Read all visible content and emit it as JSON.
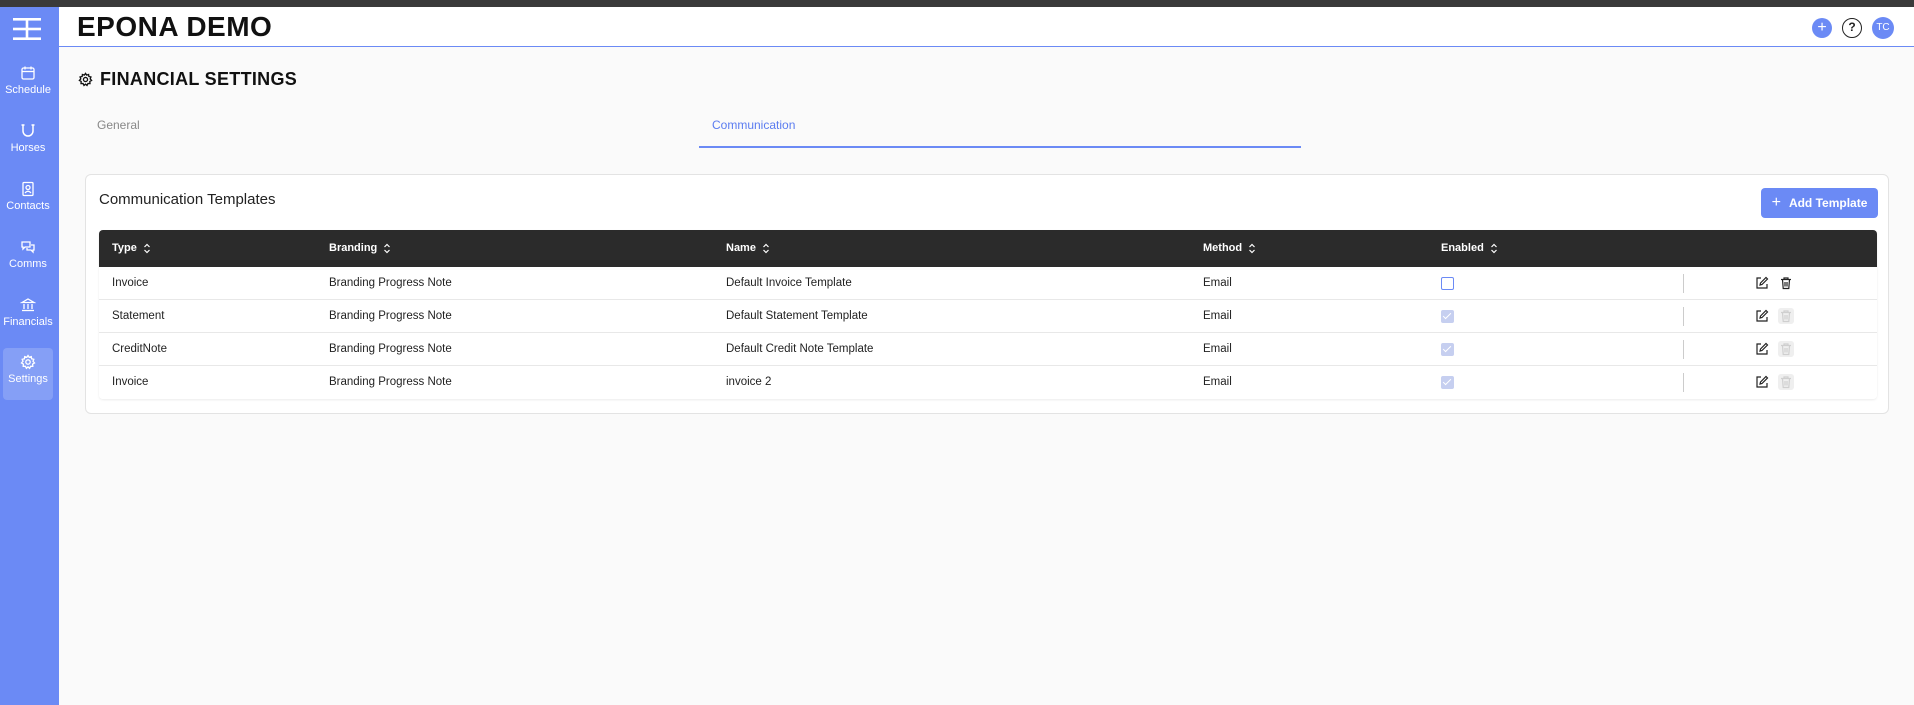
{
  "app": {
    "title": "EPONA DEMO"
  },
  "header": {
    "avatar_initials": "TC",
    "add_icon": "plus-icon",
    "help_icon": "question-circle-icon"
  },
  "sidebar": {
    "items": [
      {
        "label": "Schedule",
        "icon": "calendar-icon",
        "active": false
      },
      {
        "label": "Horses",
        "icon": "horseshoe-icon",
        "active": false
      },
      {
        "label": "Contacts",
        "icon": "contact-book-icon",
        "active": false
      },
      {
        "label": "Comms",
        "icon": "chat-bubbles-icon",
        "active": false
      },
      {
        "label": "Financials",
        "icon": "bank-icon",
        "active": false
      },
      {
        "label": "Settings",
        "icon": "gear-icon",
        "active": true
      }
    ]
  },
  "page": {
    "title": "FINANCIAL SETTINGS",
    "tabs": [
      {
        "label": "General",
        "active": false
      },
      {
        "label": "Communication",
        "active": true
      }
    ]
  },
  "panel": {
    "title": "Communication Templates",
    "add_button_label": "Add Template"
  },
  "table": {
    "columns": [
      "Type",
      "Branding",
      "Name",
      "Method",
      "Enabled"
    ],
    "rows": [
      {
        "type": "Invoice",
        "branding": "Branding Progress Note",
        "name": "Default Invoice Template",
        "method": "Email",
        "enabled": false,
        "delete_enabled": true
      },
      {
        "type": "Statement",
        "branding": "Branding Progress Note",
        "name": "Default Statement Template",
        "method": "Email",
        "enabled": true,
        "delete_enabled": false
      },
      {
        "type": "CreditNote",
        "branding": "Branding Progress Note",
        "name": "Default Credit Note Template",
        "method": "Email",
        "enabled": true,
        "delete_enabled": false
      },
      {
        "type": "Invoice",
        "branding": "Branding Progress Note",
        "name": "invoice 2",
        "method": "Email",
        "enabled": true,
        "delete_enabled": false
      }
    ]
  },
  "colors": {
    "accent": "#6b8af5",
    "table_header": "#2b2b2b",
    "sidebar": "#6b8af5"
  }
}
